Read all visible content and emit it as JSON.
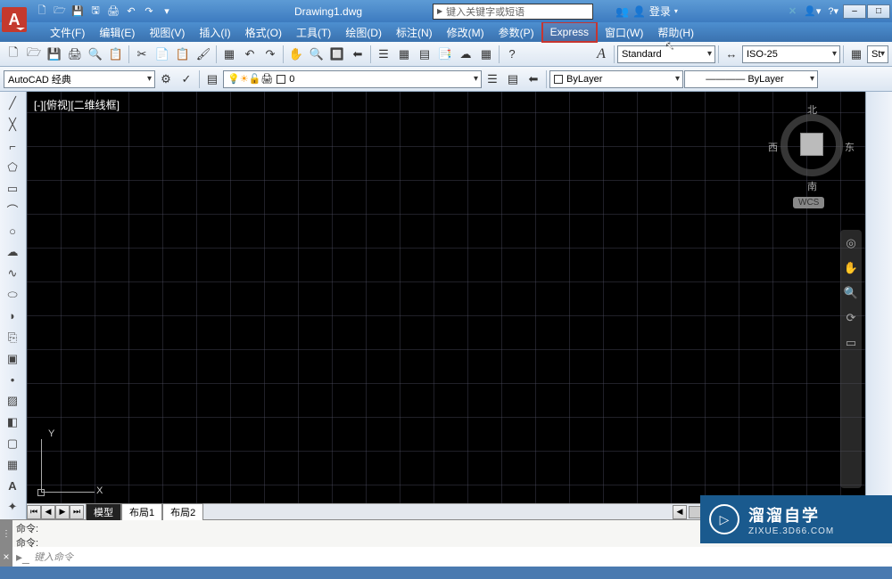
{
  "title": {
    "filename": "Drawing1.dwg",
    "search_placeholder": "键入关键字或短语",
    "login": "登录"
  },
  "menu": {
    "items": [
      "文件(F)",
      "编辑(E)",
      "视图(V)",
      "插入(I)",
      "格式(O)",
      "工具(T)",
      "绘图(D)",
      "标注(N)",
      "修改(M)",
      "参数(P)",
      "Express",
      "窗口(W)",
      "帮助(H)"
    ],
    "highlighted_index": 10
  },
  "toolbar2": {
    "style_label": "Standard",
    "dim_label": "ISO-25",
    "st_label": "St"
  },
  "toolbar3": {
    "workspace": "AutoCAD 经典",
    "layer_value": "0",
    "bylayer": "ByLayer",
    "bylayer2": "ByLayer"
  },
  "canvas": {
    "view_label": "[-][俯视][二维线框]",
    "ucs_x": "X",
    "ucs_y": "Y"
  },
  "viewcube": {
    "n": "北",
    "s": "南",
    "e": "东",
    "w": "西",
    "wcs": "WCS"
  },
  "tabs": {
    "model": "模型",
    "layout1": "布局1",
    "layout2": "布局2"
  },
  "cmd": {
    "prompt": "命令:",
    "placeholder": "键入命令"
  },
  "watermark": {
    "title": "溜溜自学",
    "url": "ZIXUE.3D66.COM"
  }
}
